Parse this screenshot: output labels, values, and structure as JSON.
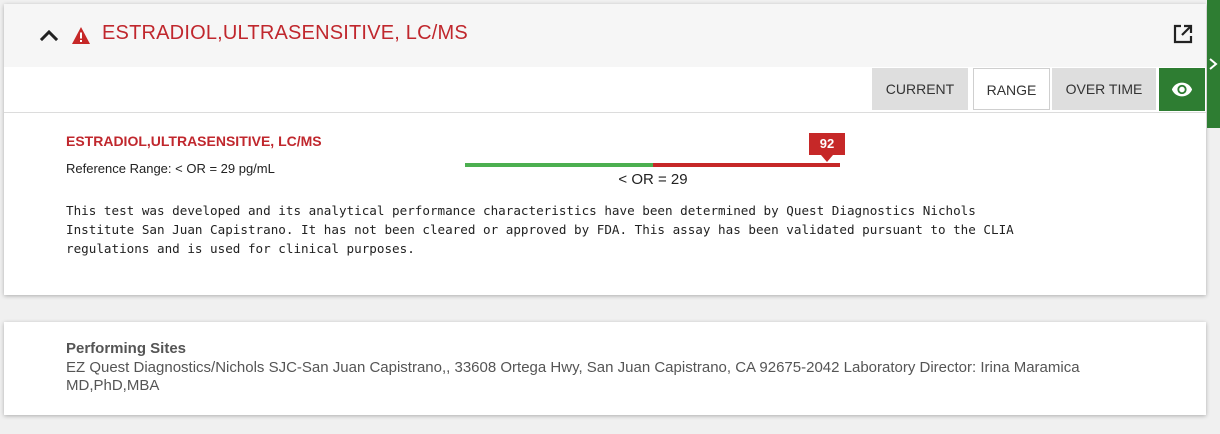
{
  "header": {
    "title": "ESTRADIOL,ULTRASENSITIVE, LC/MS",
    "warning_icon": "warning-triangle-icon",
    "collapse_icon": "chevron-up-icon",
    "external_icon": "open-in-new-icon",
    "accent_color": "#c0272d"
  },
  "tabs": [
    {
      "label": "CURRENT",
      "active": false
    },
    {
      "label": "RANGE",
      "active": true
    },
    {
      "label": "OVER TIME",
      "active": false
    }
  ],
  "view_toggle": {
    "icon": "eye-icon",
    "color": "#2e7d32"
  },
  "result": {
    "name": "ESTRADIOL,ULTRASENSITIVE, LC/MS",
    "reference_range": "Reference Range: < OR = 29 pg/mL",
    "value": "92",
    "range_label": "< OR = 29",
    "status_colors": {
      "normal": "#4caf50",
      "abnormal": "#c62828"
    }
  },
  "comment": {
    "line1": "This test was developed and its analytical performance characteristics have been determined by Quest Diagnostics Nichols",
    "line2": "Institute San Juan Capistrano. It has not been cleared or approved by FDA. This assay has been validated pursuant to the CLIA",
    "line3": "regulations and is used for clinical purposes."
  },
  "performing_sites": {
    "title": "Performing Sites",
    "text": "EZ Quest Diagnostics/Nichols SJC-San Juan Capistrano,, 33608 Ortega Hwy, San Juan Capistrano, CA 92675-2042 Laboratory Director: Irina Maramica MD,PhD,MBA"
  },
  "side_panel": {
    "icon": "chevron-right-icon",
    "color": "#2e7d32"
  }
}
